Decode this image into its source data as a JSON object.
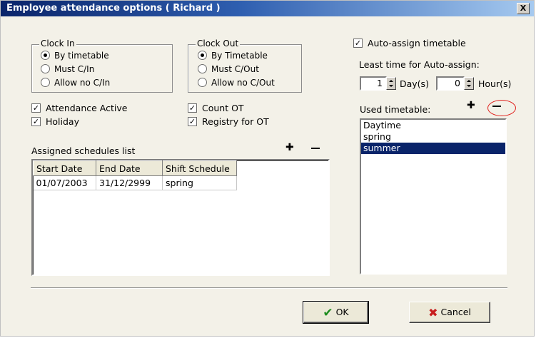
{
  "window": {
    "title": "Employee attendance options ( Richard )",
    "close_glyph": "X"
  },
  "clock_in": {
    "title": "Clock In",
    "options": [
      "By timetable",
      "Must C/In",
      "Allow no C/In"
    ],
    "selected": "By timetable"
  },
  "clock_out": {
    "title": "Clock Out",
    "options": [
      "By Timetable",
      "Must C/Out",
      "Allow no C/Out"
    ],
    "selected": "By Timetable"
  },
  "checks": {
    "attendance_active": {
      "label": "Attendance Active",
      "checked": true
    },
    "holiday": {
      "label": "Holiday",
      "checked": true
    },
    "count_ot": {
      "label": "Count OT",
      "checked": true
    },
    "registry_for_ot": {
      "label": "Registry for OT",
      "checked": true
    },
    "auto_assign": {
      "label": "Auto-assign timetable",
      "checked": true
    }
  },
  "schedules": {
    "label": "Assigned schedules list",
    "columns": [
      "Start Date",
      "End Date",
      "Shift Schedule"
    ],
    "rows": [
      [
        "01/07/2003",
        "31/12/2999",
        "spring"
      ]
    ]
  },
  "auto_assign": {
    "least_time_label": "Least time for Auto-assign:",
    "days_value": "1",
    "days_unit": "Day(s)",
    "hours_value": "0",
    "hours_unit": "Hour(s)"
  },
  "used_timetable": {
    "label": "Used timetable:",
    "items": [
      "Daytime",
      "spring",
      "summer"
    ],
    "selected": "summer"
  },
  "buttons": {
    "ok": "OK",
    "cancel": "Cancel"
  },
  "colors": {
    "selection": "#0a246a",
    "annotation": "#e0201c",
    "ok_icon": "#1e8c1e",
    "cancel_icon": "#c81e1e"
  },
  "icons": [
    "close-icon",
    "add-icon",
    "remove-icon",
    "checkmark-icon",
    "x-icon",
    "spin-up-icon",
    "spin-down-icon"
  ]
}
